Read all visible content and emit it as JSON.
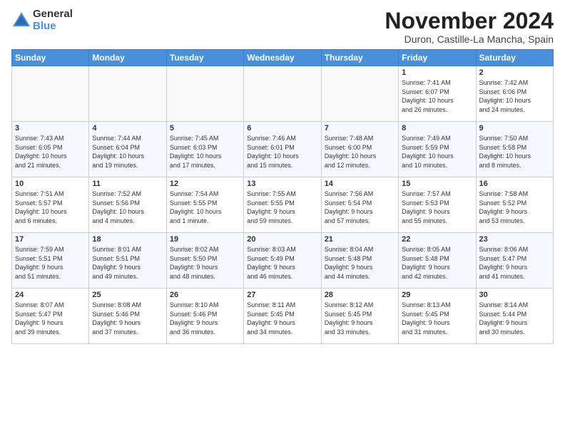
{
  "logo": {
    "general": "General",
    "blue": "Blue"
  },
  "header": {
    "month_year": "November 2024",
    "location": "Duron, Castille-La Mancha, Spain"
  },
  "weekdays": [
    "Sunday",
    "Monday",
    "Tuesday",
    "Wednesday",
    "Thursday",
    "Friday",
    "Saturday"
  ],
  "weeks": [
    [
      {
        "day": "",
        "info": ""
      },
      {
        "day": "",
        "info": ""
      },
      {
        "day": "",
        "info": ""
      },
      {
        "day": "",
        "info": ""
      },
      {
        "day": "",
        "info": ""
      },
      {
        "day": "1",
        "info": "Sunrise: 7:41 AM\nSunset: 6:07 PM\nDaylight: 10 hours\nand 26 minutes."
      },
      {
        "day": "2",
        "info": "Sunrise: 7:42 AM\nSunset: 6:06 PM\nDaylight: 10 hours\nand 24 minutes."
      }
    ],
    [
      {
        "day": "3",
        "info": "Sunrise: 7:43 AM\nSunset: 6:05 PM\nDaylight: 10 hours\nand 21 minutes."
      },
      {
        "day": "4",
        "info": "Sunrise: 7:44 AM\nSunset: 6:04 PM\nDaylight: 10 hours\nand 19 minutes."
      },
      {
        "day": "5",
        "info": "Sunrise: 7:45 AM\nSunset: 6:03 PM\nDaylight: 10 hours\nand 17 minutes."
      },
      {
        "day": "6",
        "info": "Sunrise: 7:46 AM\nSunset: 6:01 PM\nDaylight: 10 hours\nand 15 minutes."
      },
      {
        "day": "7",
        "info": "Sunrise: 7:48 AM\nSunset: 6:00 PM\nDaylight: 10 hours\nand 12 minutes."
      },
      {
        "day": "8",
        "info": "Sunrise: 7:49 AM\nSunset: 5:59 PM\nDaylight: 10 hours\nand 10 minutes."
      },
      {
        "day": "9",
        "info": "Sunrise: 7:50 AM\nSunset: 5:58 PM\nDaylight: 10 hours\nand 8 minutes."
      }
    ],
    [
      {
        "day": "10",
        "info": "Sunrise: 7:51 AM\nSunset: 5:57 PM\nDaylight: 10 hours\nand 6 minutes."
      },
      {
        "day": "11",
        "info": "Sunrise: 7:52 AM\nSunset: 5:56 PM\nDaylight: 10 hours\nand 4 minutes."
      },
      {
        "day": "12",
        "info": "Sunrise: 7:54 AM\nSunset: 5:55 PM\nDaylight: 10 hours\nand 1 minute."
      },
      {
        "day": "13",
        "info": "Sunrise: 7:55 AM\nSunset: 5:55 PM\nDaylight: 9 hours\nand 59 minutes."
      },
      {
        "day": "14",
        "info": "Sunrise: 7:56 AM\nSunset: 5:54 PM\nDaylight: 9 hours\nand 57 minutes."
      },
      {
        "day": "15",
        "info": "Sunrise: 7:57 AM\nSunset: 5:53 PM\nDaylight: 9 hours\nand 55 minutes."
      },
      {
        "day": "16",
        "info": "Sunrise: 7:58 AM\nSunset: 5:52 PM\nDaylight: 9 hours\nand 53 minutes."
      }
    ],
    [
      {
        "day": "17",
        "info": "Sunrise: 7:59 AM\nSunset: 5:51 PM\nDaylight: 9 hours\nand 51 minutes."
      },
      {
        "day": "18",
        "info": "Sunrise: 8:01 AM\nSunset: 5:51 PM\nDaylight: 9 hours\nand 49 minutes."
      },
      {
        "day": "19",
        "info": "Sunrise: 8:02 AM\nSunset: 5:50 PM\nDaylight: 9 hours\nand 48 minutes."
      },
      {
        "day": "20",
        "info": "Sunrise: 8:03 AM\nSunset: 5:49 PM\nDaylight: 9 hours\nand 46 minutes."
      },
      {
        "day": "21",
        "info": "Sunrise: 8:04 AM\nSunset: 5:48 PM\nDaylight: 9 hours\nand 44 minutes."
      },
      {
        "day": "22",
        "info": "Sunrise: 8:05 AM\nSunset: 5:48 PM\nDaylight: 9 hours\nand 42 minutes."
      },
      {
        "day": "23",
        "info": "Sunrise: 8:06 AM\nSunset: 5:47 PM\nDaylight: 9 hours\nand 41 minutes."
      }
    ],
    [
      {
        "day": "24",
        "info": "Sunrise: 8:07 AM\nSunset: 5:47 PM\nDaylight: 9 hours\nand 39 minutes."
      },
      {
        "day": "25",
        "info": "Sunrise: 8:08 AM\nSunset: 5:46 PM\nDaylight: 9 hours\nand 37 minutes."
      },
      {
        "day": "26",
        "info": "Sunrise: 8:10 AM\nSunset: 5:46 PM\nDaylight: 9 hours\nand 36 minutes."
      },
      {
        "day": "27",
        "info": "Sunrise: 8:11 AM\nSunset: 5:45 PM\nDaylight: 9 hours\nand 34 minutes."
      },
      {
        "day": "28",
        "info": "Sunrise: 8:12 AM\nSunset: 5:45 PM\nDaylight: 9 hours\nand 33 minutes."
      },
      {
        "day": "29",
        "info": "Sunrise: 8:13 AM\nSunset: 5:45 PM\nDaylight: 9 hours\nand 31 minutes."
      },
      {
        "day": "30",
        "info": "Sunrise: 8:14 AM\nSunset: 5:44 PM\nDaylight: 9 hours\nand 30 minutes."
      }
    ]
  ]
}
